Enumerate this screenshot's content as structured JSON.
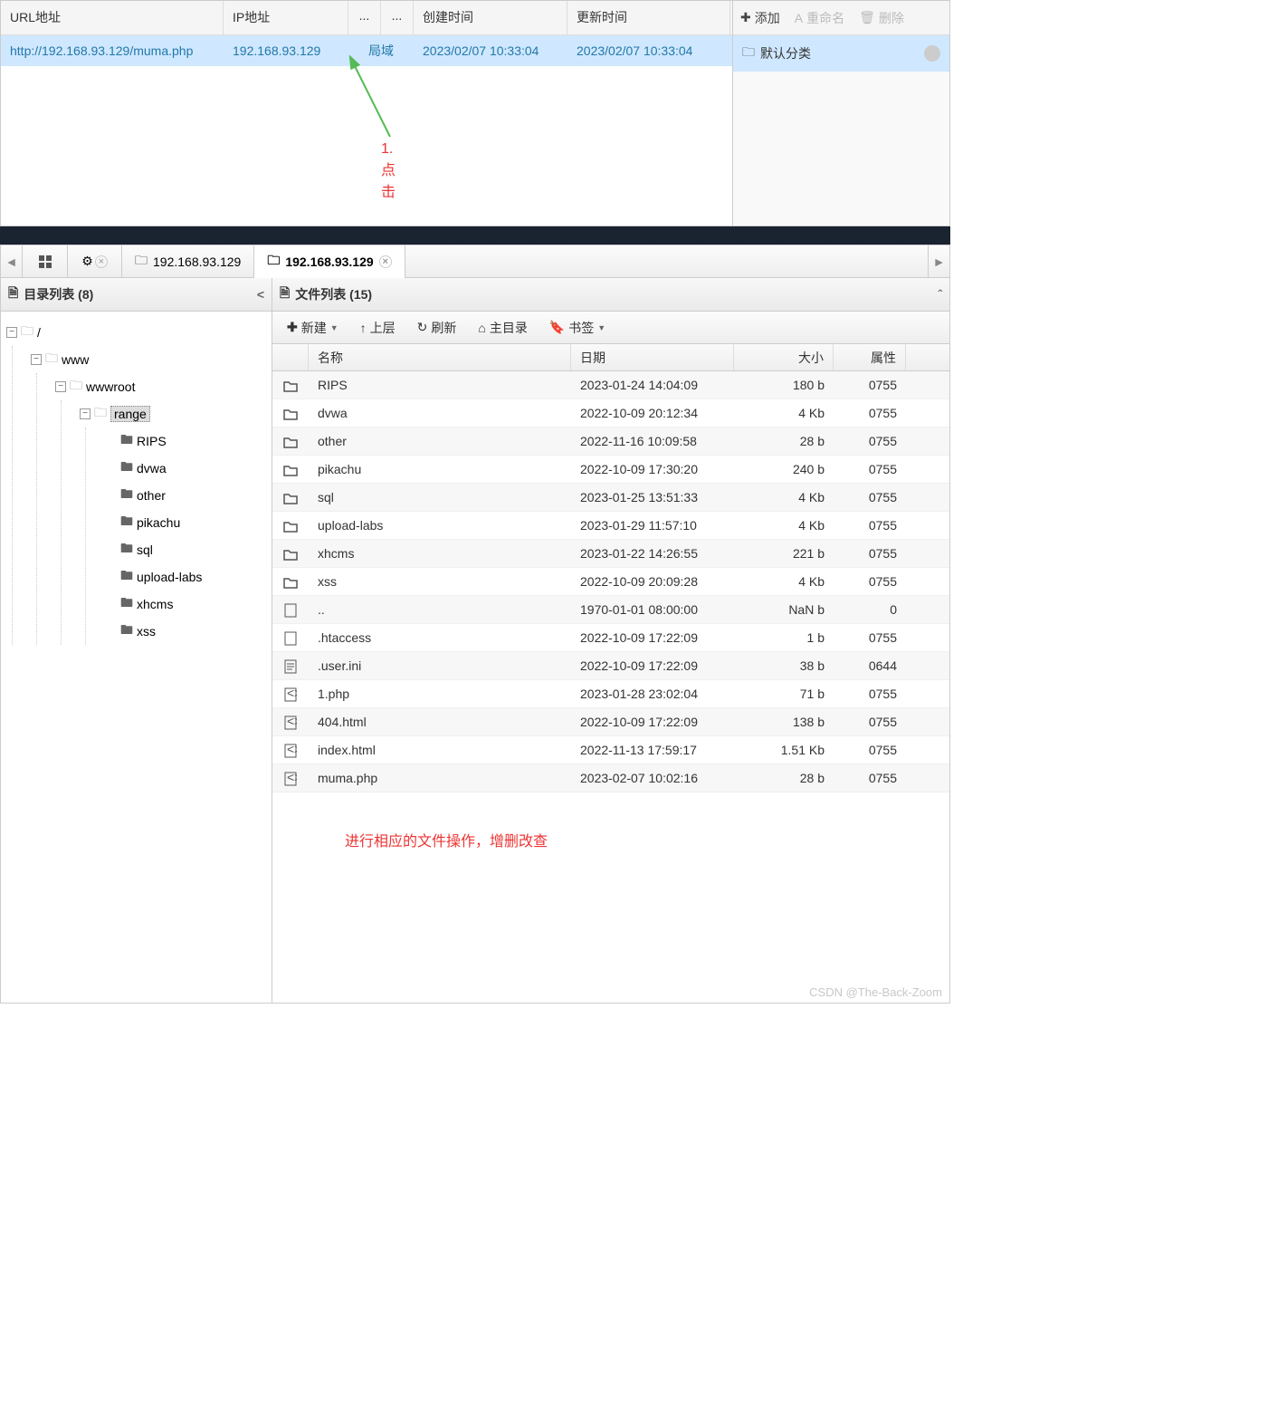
{
  "top": {
    "headers": {
      "url": "URL地址",
      "ip": "IP地址",
      "d1": "...",
      "d2": "...",
      "ctime": "创建时间",
      "utime": "更新时间"
    },
    "row": {
      "url": "http://192.168.93.129/muma.php",
      "ip": "192.168.93.129",
      "loc": "局域",
      "ctime": "2023/02/07 10:33:04",
      "utime": "2023/02/07 10:33:04"
    },
    "side": {
      "add": "添加",
      "rename": "重命名",
      "delete": "删除",
      "category": "默认分类"
    },
    "anno": "1. 点击"
  },
  "tabs": {
    "t1": "192.168.93.129",
    "t2": "192.168.93.129"
  },
  "tree": {
    "title": "目录列表 (8)",
    "root": "/",
    "www": "www",
    "wwwroot": "wwwroot",
    "range": "range",
    "leaves": [
      "RIPS",
      "dvwa",
      "other",
      "pikachu",
      "sql",
      "upload-labs",
      "xhcms",
      "xss"
    ]
  },
  "filepane": {
    "title": "文件列表 (15)",
    "toolbar": {
      "new": "新建",
      "up": "上层",
      "refresh": "刷新",
      "home": "主目录",
      "bookmark": "书签"
    },
    "headers": {
      "name": "名称",
      "date": "日期",
      "size": "大小",
      "attr": "属性"
    },
    "rows": [
      {
        "type": "folder",
        "name": "RIPS",
        "date": "2023-01-24 14:04:09",
        "size": "180 b",
        "attr": "0755"
      },
      {
        "type": "folder",
        "name": "dvwa",
        "date": "2022-10-09 20:12:34",
        "size": "4 Kb",
        "attr": "0755"
      },
      {
        "type": "folder",
        "name": "other",
        "date": "2022-11-16 10:09:58",
        "size": "28 b",
        "attr": "0755"
      },
      {
        "type": "folder",
        "name": "pikachu",
        "date": "2022-10-09 17:30:20",
        "size": "240 b",
        "attr": "0755"
      },
      {
        "type": "folder",
        "name": "sql",
        "date": "2023-01-25 13:51:33",
        "size": "4 Kb",
        "attr": "0755"
      },
      {
        "type": "folder",
        "name": "upload-labs",
        "date": "2023-01-29 11:57:10",
        "size": "4 Kb",
        "attr": "0755"
      },
      {
        "type": "folder",
        "name": "xhcms",
        "date": "2023-01-22 14:26:55",
        "size": "221 b",
        "attr": "0755"
      },
      {
        "type": "folder",
        "name": "xss",
        "date": "2022-10-09 20:09:28",
        "size": "4 Kb",
        "attr": "0755"
      },
      {
        "type": "file",
        "name": "..",
        "date": "1970-01-01 08:00:00",
        "size": "NaN b",
        "attr": "0"
      },
      {
        "type": "file",
        "name": ".htaccess",
        "date": "2022-10-09 17:22:09",
        "size": "1 b",
        "attr": "0755"
      },
      {
        "type": "text",
        "name": ".user.ini",
        "date": "2022-10-09 17:22:09",
        "size": "38 b",
        "attr": "0644"
      },
      {
        "type": "code",
        "name": "1.php",
        "date": "2023-01-28 23:02:04",
        "size": "71 b",
        "attr": "0755"
      },
      {
        "type": "code",
        "name": "404.html",
        "date": "2022-10-09 17:22:09",
        "size": "138 b",
        "attr": "0755"
      },
      {
        "type": "code",
        "name": "index.html",
        "date": "2022-11-13 17:59:17",
        "size": "1.51 Kb",
        "attr": "0755"
      },
      {
        "type": "code",
        "name": "muma.php",
        "date": "2023-02-07 10:02:16",
        "size": "28 b",
        "attr": "0755"
      }
    ],
    "anno": "进行相应的文件操作，增删改查"
  },
  "watermark": "CSDN @The-Back-Zoom"
}
